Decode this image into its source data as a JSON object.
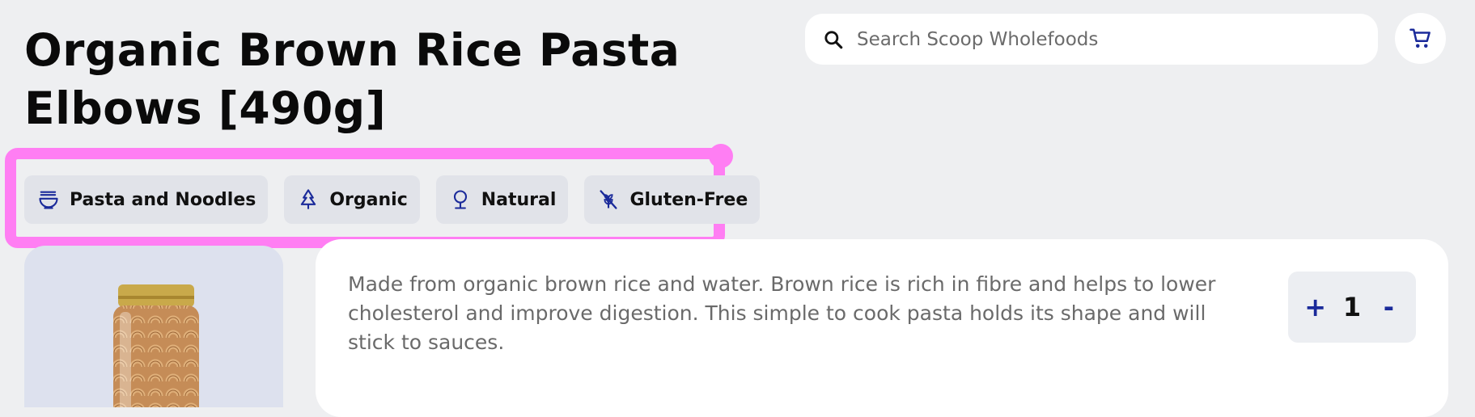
{
  "product": {
    "title": "Organic Brown Rice Pasta Elbows [490g]",
    "description": "Made from organic brown rice and water. Brown rice is rich in fibre and helps to lower cholesterol and improve digestion. This simple to cook pasta holds its shape and will stick to sauces.",
    "image_alt": "Jar of brown rice pasta elbows"
  },
  "search": {
    "placeholder": "Search Scoop Wholefoods",
    "icon": "search-icon"
  },
  "cart": {
    "icon": "cart-icon"
  },
  "tags": [
    {
      "label": "Pasta and Noodles",
      "icon": "noodle-bowl-icon"
    },
    {
      "label": "Organic",
      "icon": "tree-icon"
    },
    {
      "label": "Natural",
      "icon": "natural-icon"
    },
    {
      "label": "Gluten-Free",
      "icon": "gluten-free-icon"
    }
  ],
  "quantity": {
    "plus": "+",
    "value": "1",
    "minus": "-"
  },
  "colors": {
    "accent": "#1a2a9a",
    "highlight": "#ff7ef3",
    "background": "#eeeff1",
    "tag_bg": "#e1e3e9"
  }
}
